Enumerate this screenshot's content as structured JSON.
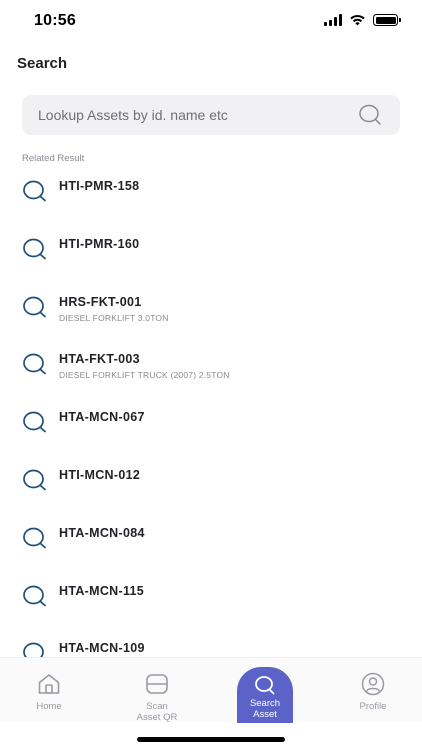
{
  "status_bar": {
    "time": "10:56"
  },
  "page": {
    "title": "Search"
  },
  "search": {
    "placeholder": "Lookup Assets by id. name etc"
  },
  "results_label": "Related Result",
  "results": [
    {
      "id": "HTI-PMR-158",
      "desc": ""
    },
    {
      "id": "HTI-PMR-160",
      "desc": ""
    },
    {
      "id": "HRS-FKT-001",
      "desc": "DIESEL FORKLIFT 3.0TON"
    },
    {
      "id": "HTA-FKT-003",
      "desc": "DIESEL FORKLIFT TRUCK (2007) 2.5TON"
    },
    {
      "id": "HTA-MCN-067",
      "desc": ""
    },
    {
      "id": "HTI-MCN-012",
      "desc": ""
    },
    {
      "id": "HTA-MCN-084",
      "desc": ""
    },
    {
      "id": "HTA-MCN-115",
      "desc": ""
    },
    {
      "id": "HTA-MCN-109",
      "desc": ""
    }
  ],
  "bottom_nav": [
    {
      "label": "Home",
      "icon": "home-icon",
      "active": false
    },
    {
      "label": "Scan\nAsset QR",
      "icon": "scan-qr-icon",
      "active": false
    },
    {
      "label": "Search\nAsset",
      "icon": "search-icon",
      "active": true
    },
    {
      "label": "Profile",
      "icon": "profile-icon",
      "active": false
    }
  ],
  "colors": {
    "accent": "#5b63c8",
    "result_icon": "#1f4e7a",
    "search_bg": "#f1f1f4"
  }
}
